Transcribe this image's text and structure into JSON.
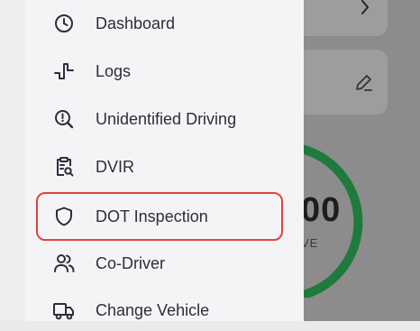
{
  "menu": {
    "items": [
      {
        "label": "Dashboard",
        "icon": "clock-icon"
      },
      {
        "label": "Logs",
        "icon": "pulse-icon"
      },
      {
        "label": "Unidentified Driving",
        "icon": "search-alert-icon"
      },
      {
        "label": "DVIR",
        "icon": "clipboard-search-icon"
      },
      {
        "label": "DOT Inspection",
        "icon": "shield-icon"
      },
      {
        "label": "Co-Driver",
        "icon": "users-icon"
      },
      {
        "label": "Change Vehicle",
        "icon": "truck-icon"
      }
    ],
    "selected_index": 4
  },
  "background": {
    "counter_value": "00",
    "counter_caption": "VE"
  },
  "colors": {
    "accent_ring": "#1f7a3d",
    "selection_border": "#e0443e",
    "text": "#2b2f3a"
  }
}
